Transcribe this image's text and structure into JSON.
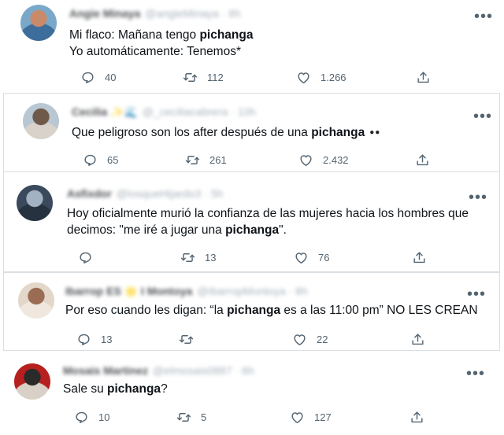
{
  "tweets": [
    {
      "author": "Angie Minaya",
      "handle": "@angieMinaya · 8h",
      "lines": [
        {
          "pre": "Mi flaco: Mañana tengo ",
          "bold": "pichanga",
          "post": ""
        },
        {
          "pre": "Yo automáticamente: Tenemos*",
          "bold": "",
          "post": ""
        }
      ],
      "replies": "40",
      "retweets": "112",
      "likes": "1.266",
      "avatar_colors": [
        "#7aa8c9",
        "#c98a6a",
        "#3d6d9a"
      ]
    },
    {
      "author": "Cecilia ✨🌊",
      "handle": "@_ceciliacabrera · 10h",
      "lines": [
        {
          "pre": "Que peligroso son los after después de una ",
          "bold": "pichanga",
          "post": "",
          "eyes": "●●"
        }
      ],
      "replies": "65",
      "retweets": "261",
      "likes": "2.432",
      "avatar_colors": [
        "#b9c7d3",
        "#6f5a4a",
        "#d8d2cb"
      ]
    },
    {
      "author": "Asfixdor",
      "handle": "@losqueHijardo3 · 5h",
      "lines": [
        {
          "pre": "Hoy oficialmente murió la confianza de las mujeres hacia los hombres que",
          "bold": "",
          "post": ""
        },
        {
          "pre": "decimos: \"me iré a jugar una ",
          "bold": "pichanga",
          "post": "\"."
        }
      ],
      "replies": "",
      "retweets": "13",
      "likes": "76",
      "avatar_colors": [
        "#3a4a5c",
        "#a3b2c2",
        "#263240"
      ]
    },
    {
      "author": "Ibarrop ES 🌟 I Montoya",
      "handle": "@IbarropMontoya · 8h",
      "lines": [
        {
          "pre": "Por eso cuando les digan: “la ",
          "bold": "pichanga",
          "post": " es a las 11:00 pm” NO LES CREAN"
        }
      ],
      "replies": "13",
      "retweets": "",
      "likes": "22",
      "avatar_colors": [
        "#e3d7c9",
        "#9a6c54",
        "#f0e8df"
      ]
    },
    {
      "author": "Mosais Martinez",
      "handle": "@elmosais0887 · 6h",
      "lines": [
        {
          "pre": "Sale su ",
          "bold": "pichanga",
          "post": "?"
        }
      ],
      "replies": "10",
      "retweets": "5",
      "likes": "127",
      "avatar_colors": [
        "#b7201f",
        "#2a2a2a",
        "#d9d1c7"
      ]
    }
  ],
  "icons": {
    "reply": "reply-icon",
    "retweet": "retweet-icon",
    "like": "heart-icon",
    "share": "share-icon",
    "more": "more-options-icon"
  },
  "more_glyph": "•••"
}
